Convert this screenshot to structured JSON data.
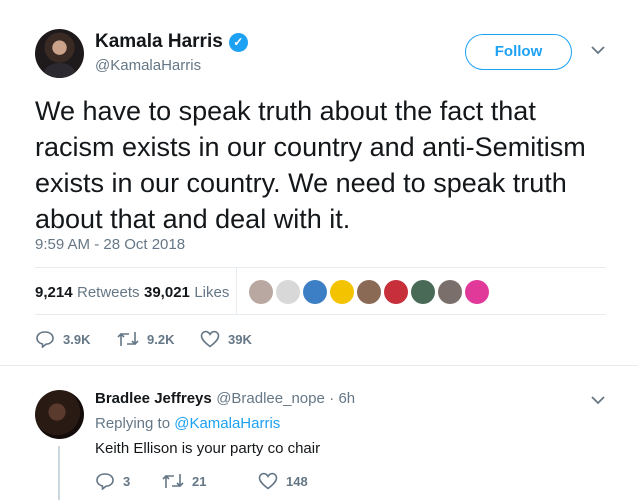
{
  "tweet": {
    "author_name": "Kamala Harris",
    "author_handle": "@KamalaHarris",
    "follow_label": "Follow",
    "text": "We have to speak truth about the fact that racism exists in our country and anti-Semitism exists in our country. We need to speak truth about that and deal with it.",
    "timestamp": "9:59 AM - 28 Oct 2018",
    "retweets_count": "9,214",
    "retweets_label": "Retweets",
    "likes_count": "39,021",
    "likes_label": "Likes",
    "actions": {
      "replies": "3.9K",
      "retweets": "9.2K",
      "likes": "39K"
    },
    "liker_colors": [
      "#b9a7a2",
      "#d8d8d8",
      "#3d7fc4",
      "#f3c300",
      "#8a6a55",
      "#c7303a",
      "#4a6a58",
      "#7a6f6a",
      "#e0399a"
    ]
  },
  "reply": {
    "author_name": "Bradlee Jeffreys",
    "author_handle": "@Bradlee_nope",
    "time_ago": "· 6h",
    "replying_prefix": "Replying to",
    "replying_handle": "@KamalaHarris",
    "text": "Keith Ellison is your party co chair",
    "actions": {
      "replies": "3",
      "retweets": "21",
      "likes": "148"
    }
  },
  "colors": {
    "accent": "#1da1f2",
    "muted": "#657786",
    "divider": "#e6ecf0"
  }
}
